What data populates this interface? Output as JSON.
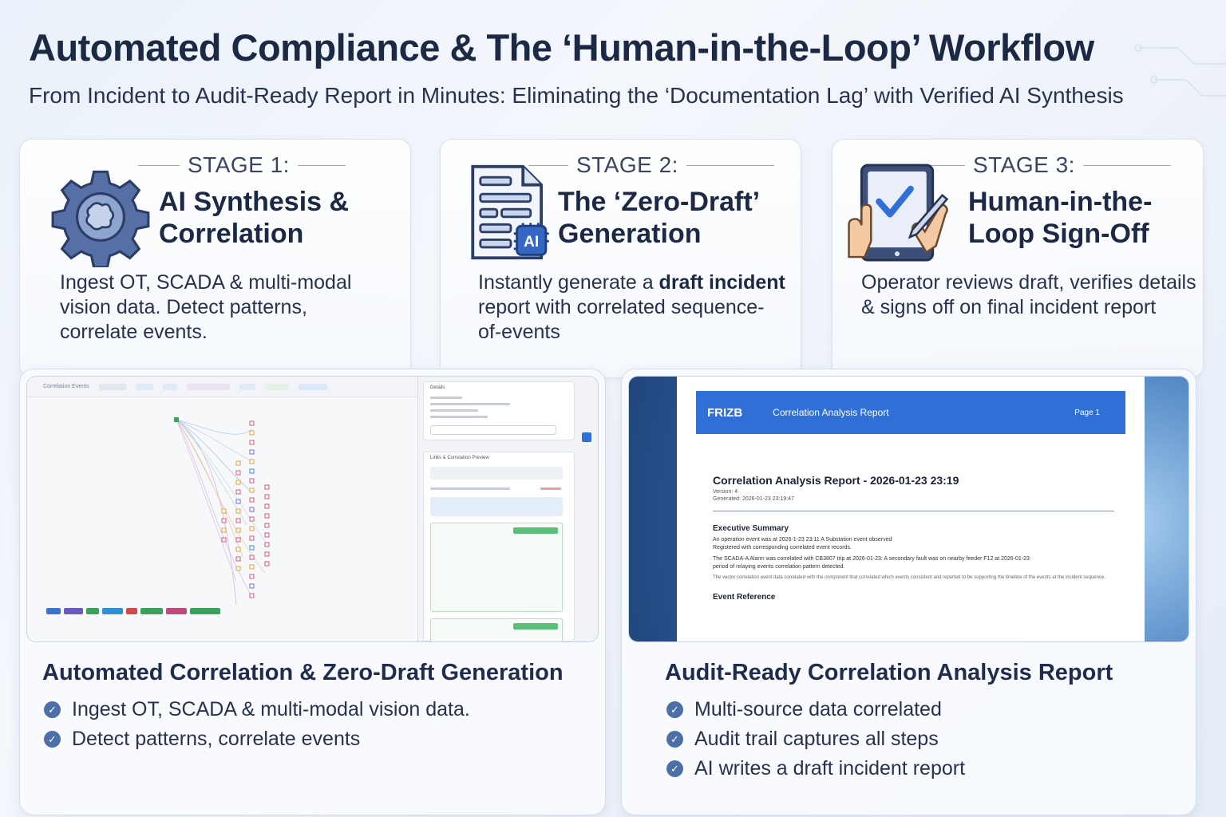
{
  "header": {
    "title": "Automated Compliance & The ‘Human-in-the-Loop’ Workflow",
    "subtitle": "From Incident to Audit-Ready Report in Minutes: Eliminating the ‘Documentation Lag’ with Verified AI Synthesis"
  },
  "stages": [
    {
      "label": "STAGE 1:",
      "name_line1": "AI Synthesis &",
      "name_line2": "Correlation",
      "desc_line1": "Ingest OT, SCADA & multi-modal",
      "desc_line2": "vision data. Detect patterns,",
      "desc_line3": "correlate events.",
      "icon": "gear-brain-icon"
    },
    {
      "label": "STAGE 2:",
      "name_line1": "The ‘Zero-Draft’",
      "name_line2": "Generation",
      "desc_pre": "Instantly generate a ",
      "desc_bold": "draft incident",
      "desc_line2": "report with correlated sequence-",
      "desc_line3": "of-events",
      "icon_badge": "AI",
      "icon": "ai-document-icon"
    },
    {
      "label": "STAGE 3:",
      "name_line1": "Human-in-the-",
      "name_line2": "Loop Sign-Off",
      "desc_line1": "Operator reviews draft, verifies details",
      "desc_line2": "& signs off on final incident report",
      "icon": "tablet-signoff-icon"
    }
  ],
  "panels": {
    "left": {
      "title": "Automated Correlation & Zero-Draft Generation",
      "bullets": [
        "Ingest OT, SCADA & multi-modal vision data.",
        "Detect patterns, correlate events"
      ],
      "app": {
        "toolbar_label": "Correlation Events",
        "side_title": "Details",
        "side_header": "Links & Correlation Preview"
      }
    },
    "right": {
      "title": "Audit-Ready Correlation Analysis Report",
      "bullets": [
        "Multi-source data correlated",
        "Audit trail captures all steps",
        "AI writes a draft incident report"
      ],
      "report": {
        "logo": "FRIZB",
        "header_title": "Correlation Analysis Report",
        "page": "Page 1",
        "doc_title": "Correlation Analysis Report - 2026-01-23 23:19",
        "meta1": "Version: 4",
        "meta2": "Generated: 2026-01-23 23:19:47",
        "exec_summary_heading": "Executive Summary",
        "exec_p1": "An operation event was at 2026-1-23 23:11 A Substation event observed",
        "exec_p1b": "Registered with corresponding correlated event records.",
        "exec_p2": "The SCADA-A Alarm was correlated with CB3807 trip at 2026-01-23: A secondary fault was on nearby feeder F12 at 2026-01-23",
        "exec_p2b": "period of relaying events correlation pattern detected.",
        "exec_p3": "The vector correlation event data correlated with the component that correlated which events consistent and reported to be supporting the timeline of the events at the incident sequence.",
        "event_ref_heading": "Event Reference"
      }
    }
  },
  "colors": {
    "accent": "#4c6fa8",
    "report_header": "#2f6fd6",
    "title_text": "#1c2945"
  }
}
